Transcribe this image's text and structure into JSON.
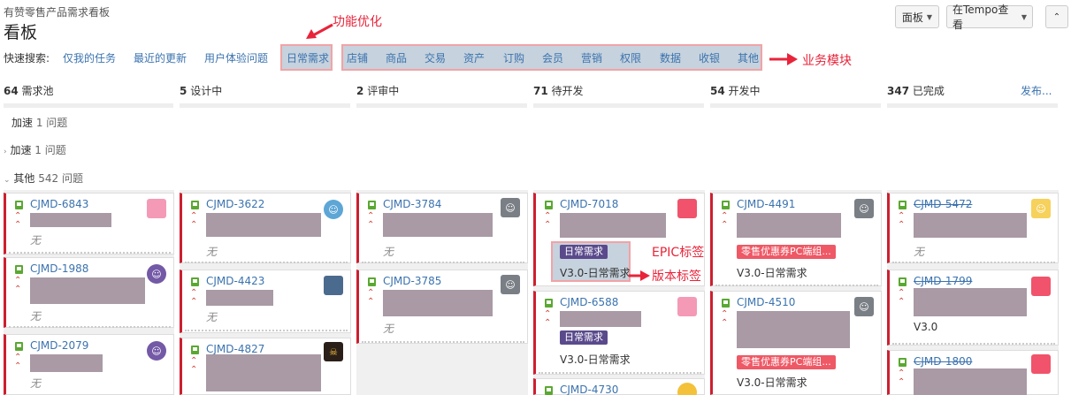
{
  "header": {
    "subtitle": "有赞零售产品需求看板",
    "title": "看板",
    "board_button": "面板",
    "tempo_button": "在Tempo查看",
    "collapse_icon": "chevron-up-icon"
  },
  "quick_search": {
    "label": "快速搜索:",
    "items": [
      "仅我的任务",
      "最近的更新",
      "用户体验问题",
      "日常需求",
      "店铺",
      "商品",
      "交易",
      "资产",
      "订购",
      "会员",
      "营销",
      "权限",
      "数据",
      "收银",
      "其他"
    ]
  },
  "annotations": {
    "function_opt": "功能优化",
    "business_module": "业务模块",
    "epic_tag": "EPIC标签",
    "version_tag": "版本标签"
  },
  "columns": [
    {
      "count": "64",
      "name": "需求池"
    },
    {
      "count": "5",
      "name": "设计中"
    },
    {
      "count": "2",
      "name": "评审中"
    },
    {
      "count": "71",
      "name": "待开发"
    },
    {
      "count": "54",
      "name": "开发中"
    },
    {
      "count": "347",
      "name": "已完成"
    }
  ],
  "release_link": "发布...",
  "swimlanes": [
    {
      "name": "加速",
      "count": "1 问题"
    },
    {
      "name": "加速",
      "count": "1 问题"
    },
    {
      "name": "其他",
      "count": "542 问题"
    }
  ],
  "cards": {
    "c6843": {
      "key": "CJMD-6843",
      "none": "无"
    },
    "c1988": {
      "key": "CJMD-1988",
      "none": "无"
    },
    "c2079": {
      "key": "CJMD-2079",
      "none": "无"
    },
    "c3622": {
      "key": "CJMD-3622",
      "none": "无"
    },
    "c4423": {
      "key": "CJMD-4423",
      "none": "无"
    },
    "c4827": {
      "key": "CJMD-4827"
    },
    "c3784": {
      "key": "CJMD-3784",
      "none": "无"
    },
    "c3785": {
      "key": "CJMD-3785",
      "none": "无"
    },
    "c7018": {
      "key": "CJMD-7018",
      "epic": "日常需求",
      "version": "V3.0-日常需求"
    },
    "c6588": {
      "key": "CJMD-6588",
      "epic": "日常需求",
      "version": "V3.0-日常需求"
    },
    "c4730": {
      "key": "CJMD-4730"
    },
    "c4491": {
      "key": "CJMD-4491",
      "epic": "零售优惠券PC端组...",
      "version": "V3.0-日常需求"
    },
    "c4510": {
      "key": "CJMD-4510",
      "epic": "零售优惠券PC端组...",
      "version": "V3.0-日常需求"
    },
    "c5472": {
      "key": "CJMD-5472",
      "none": "无"
    },
    "c1799": {
      "key": "CJMD-1799",
      "version": "V3.0"
    },
    "c1800": {
      "key": "CJMD-1800"
    }
  },
  "colors": {
    "link": "#3b73af",
    "annotation": "#e8243a",
    "card_border": "#cc1f2f",
    "redaction": "#a99aa5"
  }
}
